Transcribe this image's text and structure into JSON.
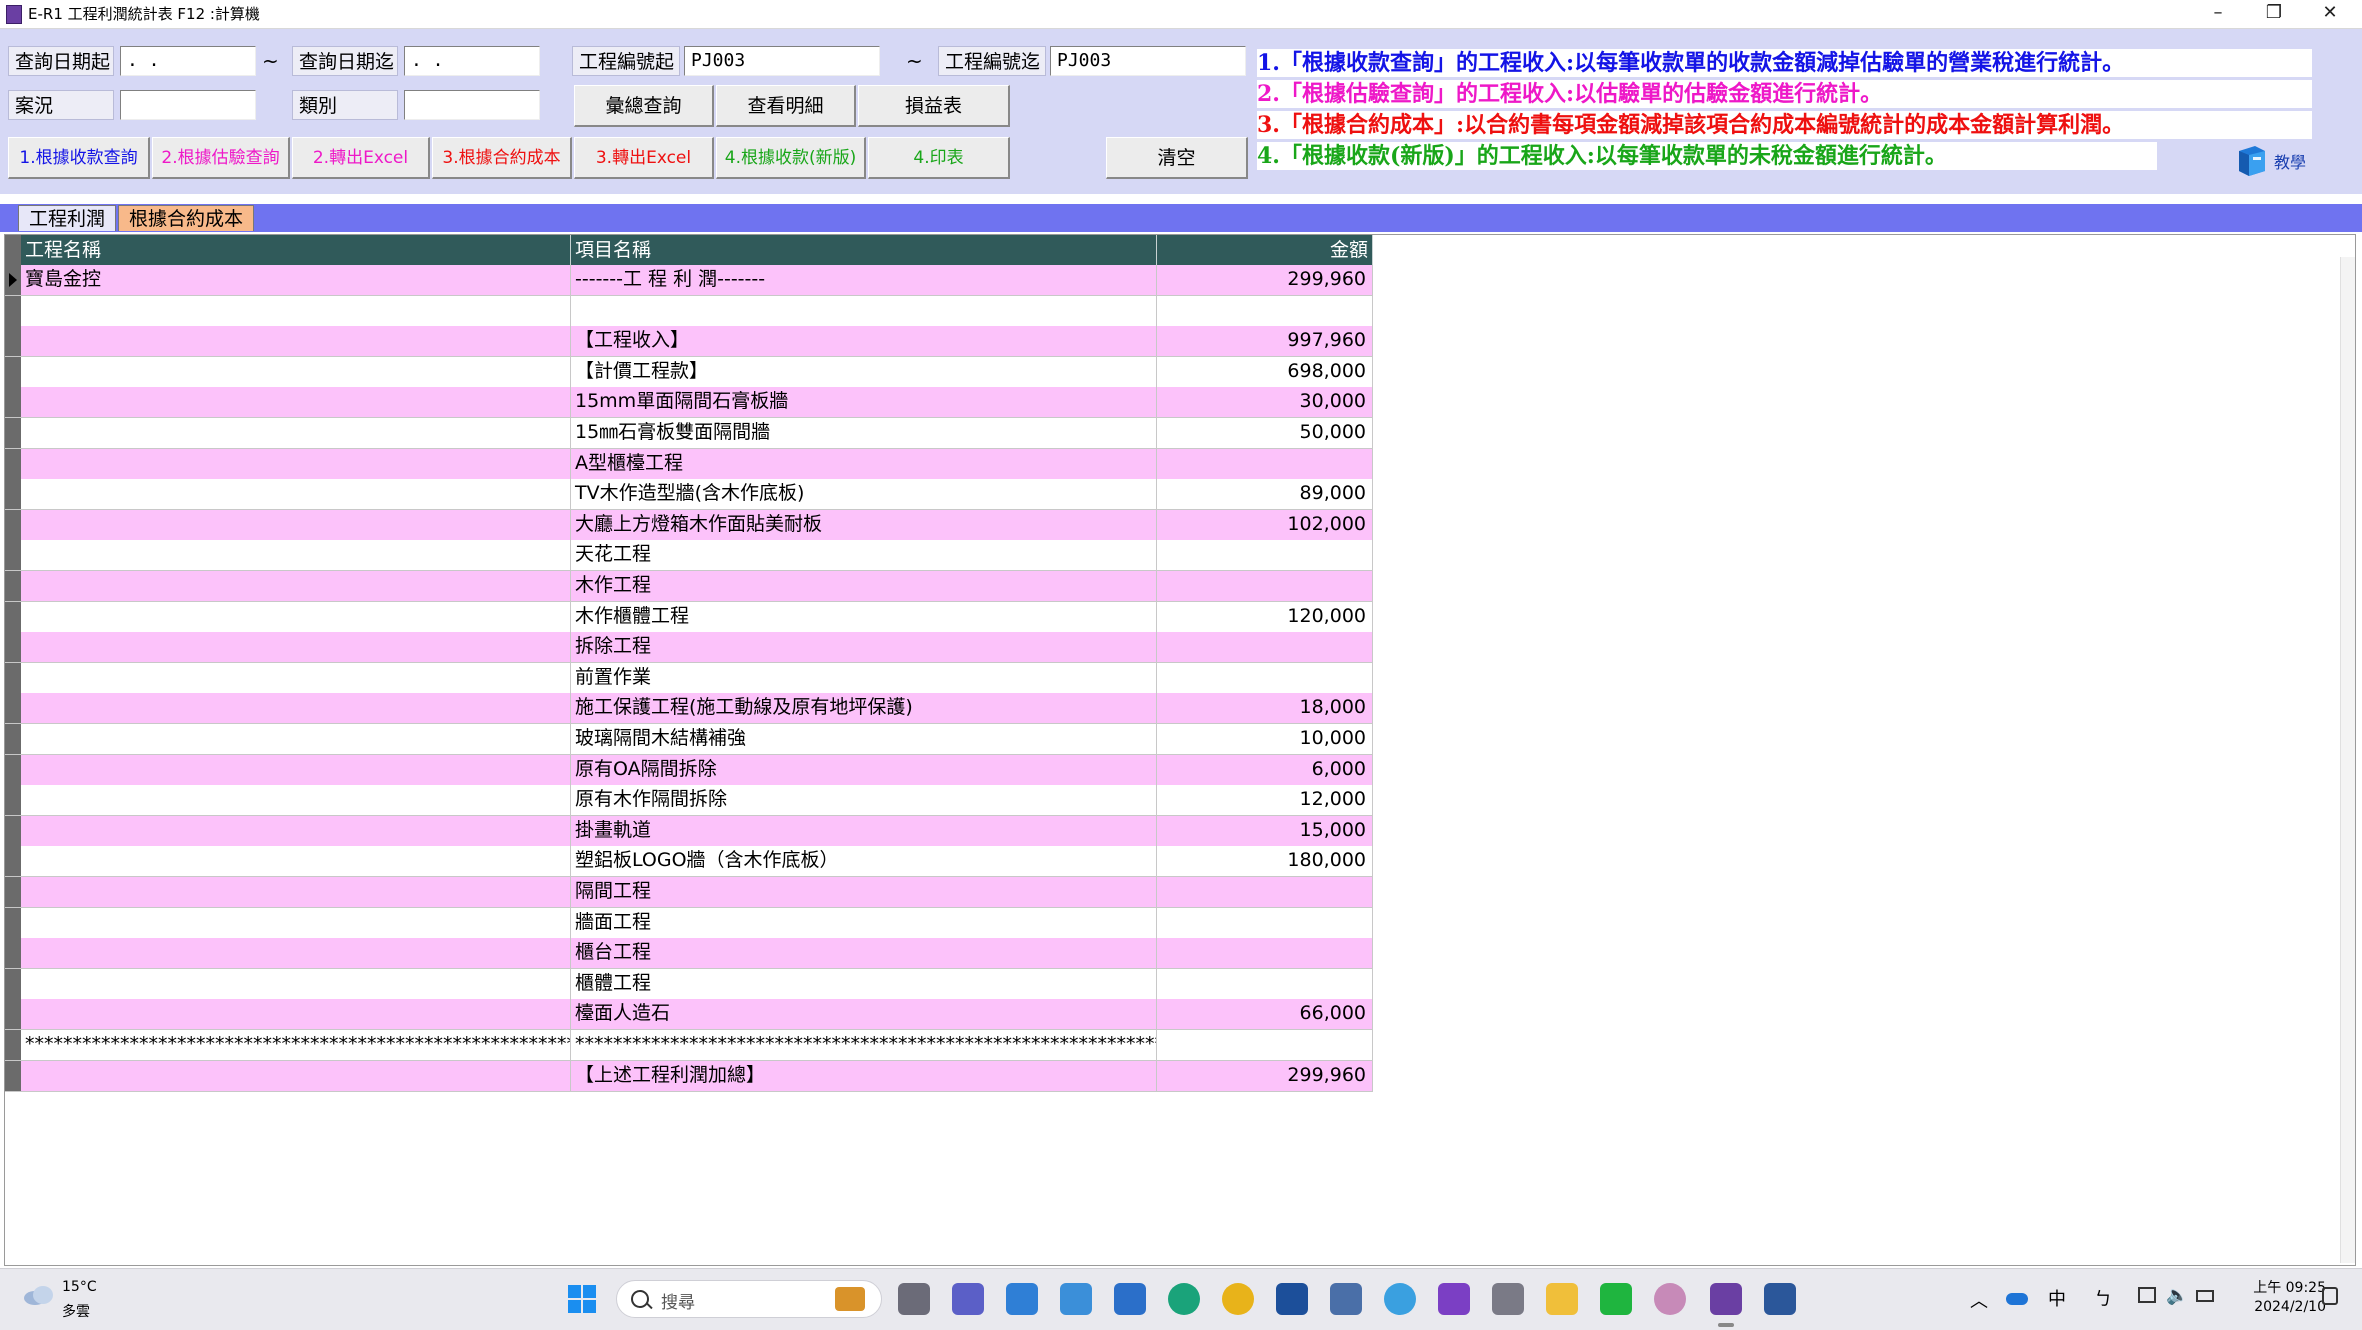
{
  "window": {
    "title": "E-R1 工程利潤統計表    F12 :計算機",
    "minimize": "–",
    "maximize": "❐",
    "close": "✕"
  },
  "filters": {
    "date_from_label": "查詢日期起",
    "date_from_value": " .  .",
    "date_to_label": "查詢日期迄",
    "date_to_value": " .  .",
    "tilde": "~",
    "case_label": "案況",
    "case_value": "",
    "category_label": "類別",
    "category_value": "",
    "project_from_label": "工程編號起",
    "project_from_value": "PJ003",
    "project_to_label": "工程編號迄",
    "project_to_value": "PJ003"
  },
  "buttons": {
    "summary_query": "彙總查詢",
    "view_detail": "查看明細",
    "profit_loss": "損益表",
    "by_receipt_query": "1.根據收款查詢",
    "by_estimate_query": "2.根據估驗查詢",
    "export_excel_2": "2.轉出Excel",
    "by_contract_cost": "3.根據合約成本",
    "export_excel_3": "3.轉出Excel",
    "by_receipt_new": "4.根據收款(新版)",
    "print_4": "4.印表",
    "clear": "清空"
  },
  "notes": [
    {
      "text": "1.「根據收款查詢」的工程收入:以每筆收款單的收款金額減掉估驗單的營業稅進行統計。",
      "color": "#1414e6"
    },
    {
      "text": "2.「根據估驗查詢」的工程收入:以估驗單的估驗金額進行統計。",
      "color": "#ee18c8"
    },
    {
      "text": "3.「根據合約成本」:以合約書每項金額減掉該項合約成本編號統計的成本金額計算利潤。",
      "color": "#ee1010"
    },
    {
      "text": "4.「根據收款(新版)」的工程收入:以每筆收款單的未稅金額進行統計。",
      "color": "#19a619"
    }
  ],
  "help": {
    "label": "教學"
  },
  "tabs": {
    "profit": "工程利潤",
    "contract_cost": "根據合約成本"
  },
  "grid": {
    "columns": [
      "工程名稱",
      "項目名稱",
      "金額"
    ],
    "rows": [
      [
        "寶島金控",
        "      -------工  程  利  潤-------",
        "299,960"
      ],
      [
        "",
        "",
        ""
      ],
      [
        "",
        "      【工程收入】",
        "997,960"
      ],
      [
        "",
        "      【計價工程款】",
        "698,000"
      ],
      [
        "",
        "15mm單面隔間石膏板牆",
        "30,000"
      ],
      [
        "",
        "15㎜石膏板雙面隔間牆",
        "50,000"
      ],
      [
        "",
        "A型櫃檯工程",
        ""
      ],
      [
        "",
        "TV木作造型牆(含木作底板)",
        "89,000"
      ],
      [
        "",
        "大廳上方燈箱木作面貼美耐板",
        "102,000"
      ],
      [
        "",
        "天花工程",
        ""
      ],
      [
        "",
        "木作工程",
        ""
      ],
      [
        "",
        "木作櫃體工程",
        "120,000"
      ],
      [
        "",
        "拆除工程",
        ""
      ],
      [
        "",
        "前置作業",
        ""
      ],
      [
        "",
        "施工保護工程(施工動線及原有地坪保護)",
        "18,000"
      ],
      [
        "",
        "玻璃隔間木結構補強",
        "10,000"
      ],
      [
        "",
        "原有OA隔間拆除",
        "6,000"
      ],
      [
        "",
        "原有木作隔間拆除",
        "12,000"
      ],
      [
        "",
        "掛畫軌道",
        "15,000"
      ],
      [
        "",
        "塑鋁板LOGO牆（含木作底板）",
        "180,000"
      ],
      [
        "",
        "隔間工程",
        ""
      ],
      [
        "",
        "牆面工程",
        ""
      ],
      [
        "",
        "櫃台工程",
        ""
      ],
      [
        "",
        "櫃體工程",
        ""
      ],
      [
        "",
        "檯面人造石",
        "66,000"
      ],
      [
        "************************************************************",
        "************************************************************************************",
        ""
      ],
      [
        "",
        "【上述工程利潤加總】",
        "299,960"
      ]
    ]
  },
  "taskbar": {
    "weather_temp": "15°C",
    "weather_desc": "多雲",
    "search_placeholder": "搜尋",
    "ime": "中",
    "ime2": "ㄅ",
    "time": "上午 09:25",
    "date": "2024/2/10",
    "tray_chevron": "︿",
    "volume": "🔈"
  },
  "colors": {
    "toolbar_bg": "#d6d8f5",
    "grid_header": "#305a5a",
    "row_pink": "#fcc2fa",
    "tab_strip": "#6f73f0"
  }
}
